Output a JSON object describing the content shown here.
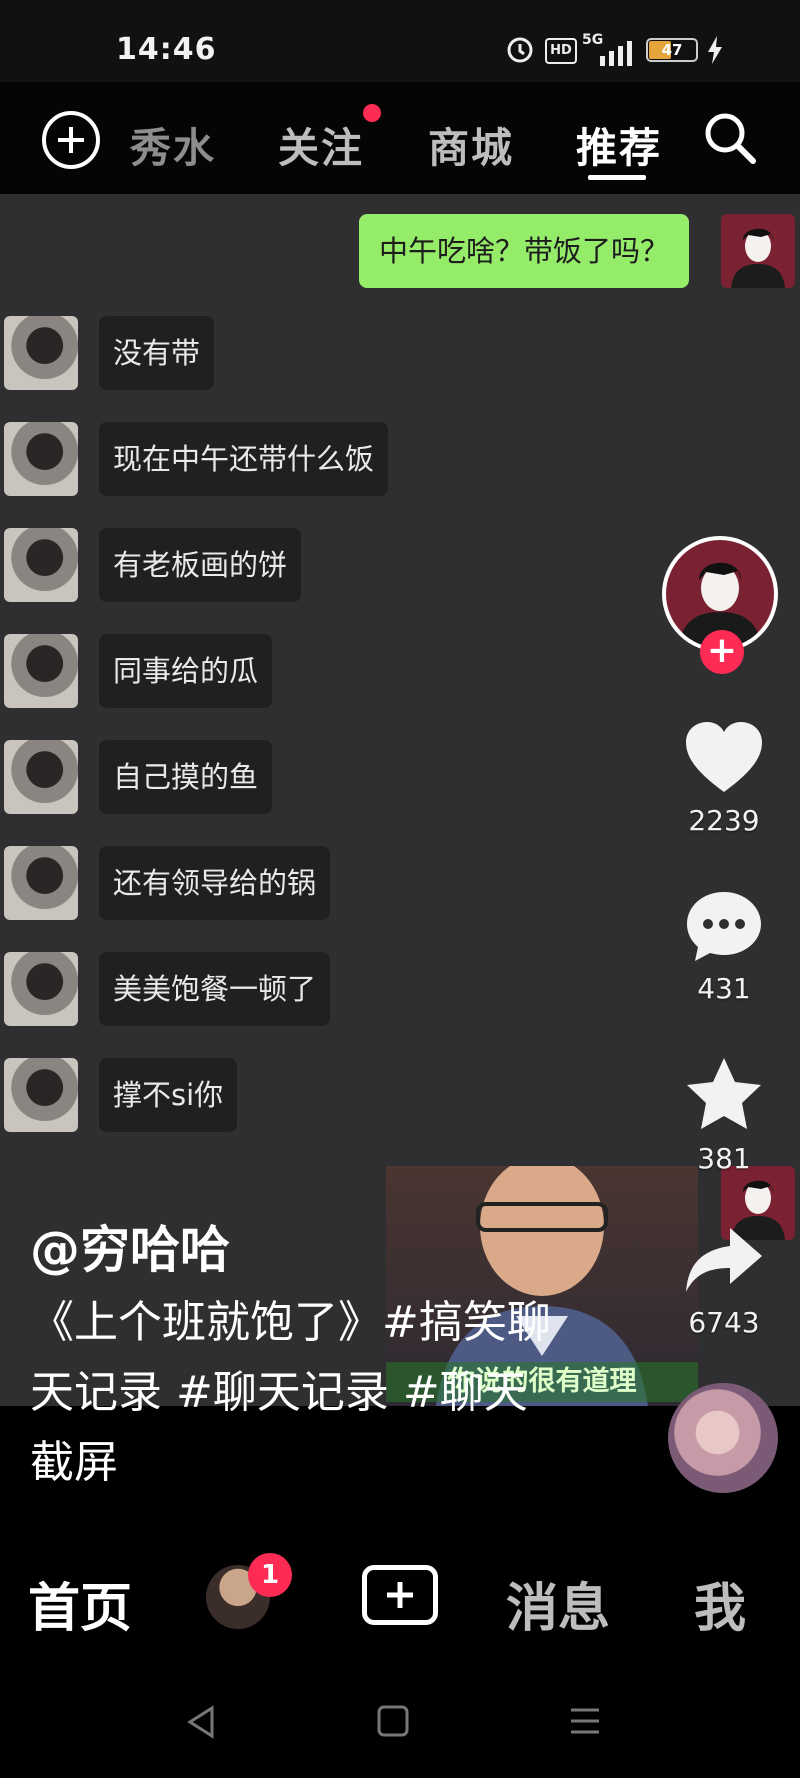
{
  "status_bar": {
    "time": "14:46",
    "battery": "47",
    "network": "5G"
  },
  "top_nav": {
    "tabs": [
      {
        "label": "秀水"
      },
      {
        "label": "关注"
      },
      {
        "label": "商城"
      },
      {
        "label": "推荐",
        "active": true
      }
    ]
  },
  "chat": {
    "self_message": "中午吃啥？带饭了吗？",
    "replies": [
      "没有带",
      "现在中午还带什么饭",
      "有老板画的饼",
      "同事给的瓜",
      "自己摸的鱼",
      "还有领导给的锅",
      "美美饱餐一顿了",
      "撑不si你"
    ]
  },
  "video_overlay": {
    "thumbnail_caption": "你说的很有道理"
  },
  "right_rail": {
    "likes": "2239",
    "comments": "431",
    "favorites": "381",
    "shares": "6743"
  },
  "caption": {
    "author": "@穷哈哈",
    "text": "《上个班就饱了》#搞笑聊天记录 #聊天记录 #聊天截屏"
  },
  "bottom_nav": {
    "home": "首页",
    "messages": "消息",
    "me": "我",
    "badge_count": "1"
  },
  "colors": {
    "accent": "#fe2c55",
    "self_bubble": "#95ec69",
    "chat_bg": "#2f2f31"
  }
}
